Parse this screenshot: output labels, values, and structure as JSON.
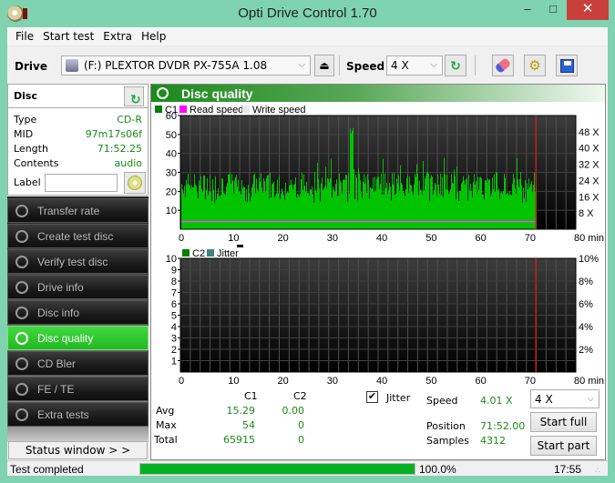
{
  "window": {
    "title": "Opti Drive Control 1.70",
    "controls": {
      "minimize": "–",
      "maximize": "□",
      "close": "✕"
    }
  },
  "menu": [
    "File",
    "Start test",
    "Extra",
    "Help"
  ],
  "toolbar": {
    "drive_label": "Drive",
    "drive_value": "(F:)  PLEXTOR DVDR   PX-755A 1.08",
    "speed_label": "Speed",
    "speed_value": "4 X",
    "icons": [
      "drive-icon",
      "eject-icon",
      "refresh-icon",
      "eraser-icon",
      "settings-icon",
      "save-icon"
    ]
  },
  "disc": {
    "header": "Disc",
    "rows": [
      {
        "key": "Type",
        "value": "CD-R"
      },
      {
        "key": "MID",
        "value": "97m17s06f"
      },
      {
        "key": "Length",
        "value": "71:52.25"
      },
      {
        "key": "Contents",
        "value": "audio"
      }
    ],
    "label_key": "Label",
    "label_value": ""
  },
  "nav": [
    {
      "label": "Transfer rate",
      "active": false
    },
    {
      "label": "Create test disc",
      "active": false
    },
    {
      "label": "Verify test disc",
      "active": false
    },
    {
      "label": "Drive info",
      "active": false
    },
    {
      "label": "Disc info",
      "active": false
    },
    {
      "label": "Disc quality",
      "active": true
    },
    {
      "label": "CD Bler",
      "active": false
    },
    {
      "label": "FE / TE",
      "active": false
    },
    {
      "label": "Extra tests",
      "active": false
    }
  ],
  "status_window_label": "Status window > >",
  "panel_title": "Disc quality",
  "chart_data": [
    {
      "type": "bar",
      "title": "C1",
      "legend": [
        {
          "name": "C1",
          "color": "#008000"
        },
        {
          "name": "Read speed",
          "color": "#ff00ff"
        },
        {
          "name": "Write speed",
          "color": "#e8e8e8"
        }
      ],
      "legend_placement": "top-left",
      "xlabel": "min",
      "xlim": [
        0,
        80
      ],
      "x_ticks": [
        "0",
        "10",
        "20",
        "30",
        "40",
        "50",
        "60",
        "70",
        "80 min"
      ],
      "ylim": [
        0,
        60
      ],
      "y_ticks": [
        "10",
        "20",
        "30",
        "40",
        "50",
        "60"
      ],
      "y2_ticks": [
        "8 X",
        "16 X",
        "24 X",
        "32 X",
        "40 X",
        "48 X"
      ],
      "y2lim": [
        0,
        56
      ],
      "end_marker_min": 71.9,
      "series": [
        {
          "name": "C1",
          "color": "#00c400",
          "baseline": 18,
          "peak_at_min": 34.5,
          "peak": 54,
          "typical_max": 30
        },
        {
          "name": "Read speed",
          "color": "#ff40ff",
          "value_x": 4
        }
      ],
      "grid": true
    },
    {
      "type": "line",
      "title": "C2",
      "legend": [
        {
          "name": "C2",
          "color": "#008000"
        },
        {
          "name": "Jitter",
          "color": "#408080"
        }
      ],
      "legend_placement": "top-left",
      "xlabel": "min",
      "xlim": [
        0,
        80
      ],
      "x_ticks": [
        "0",
        "10",
        "20",
        "30",
        "40",
        "50",
        "60",
        "70",
        "80 min"
      ],
      "ylim": [
        0,
        10
      ],
      "y_ticks": [
        "1",
        "2",
        "3",
        "4",
        "5",
        "6",
        "7",
        "8",
        "9",
        "10"
      ],
      "y2_ticks": [
        "2%",
        "4%",
        "6%",
        "8%",
        "10%"
      ],
      "end_marker_min": 71.9,
      "series": [
        {
          "name": "C2",
          "values": []
        }
      ],
      "grid": true
    }
  ],
  "stats": {
    "col_c1": "C1",
    "col_c2": "C2",
    "rows": [
      {
        "label": "Avg",
        "c1": "15.29",
        "c2": "0.00"
      },
      {
        "label": "Max",
        "c1": "54",
        "c2": "0"
      },
      {
        "label": "Total",
        "c1": "65915",
        "c2": "0"
      }
    ],
    "jitter_label": "Jitter",
    "jitter_checked": true
  },
  "readout": {
    "speed_label": "Speed",
    "speed_value": "4.01 X",
    "position_label": "Position",
    "position_value": "71:52.00",
    "samples_label": "Samples",
    "samples_value": "4312",
    "speed_select": "4 X",
    "start_full": "Start full",
    "start_part": "Start part"
  },
  "statusbar": {
    "message": "Test completed",
    "progress": 100,
    "progress_text": "100.0%",
    "time": "17:55"
  }
}
